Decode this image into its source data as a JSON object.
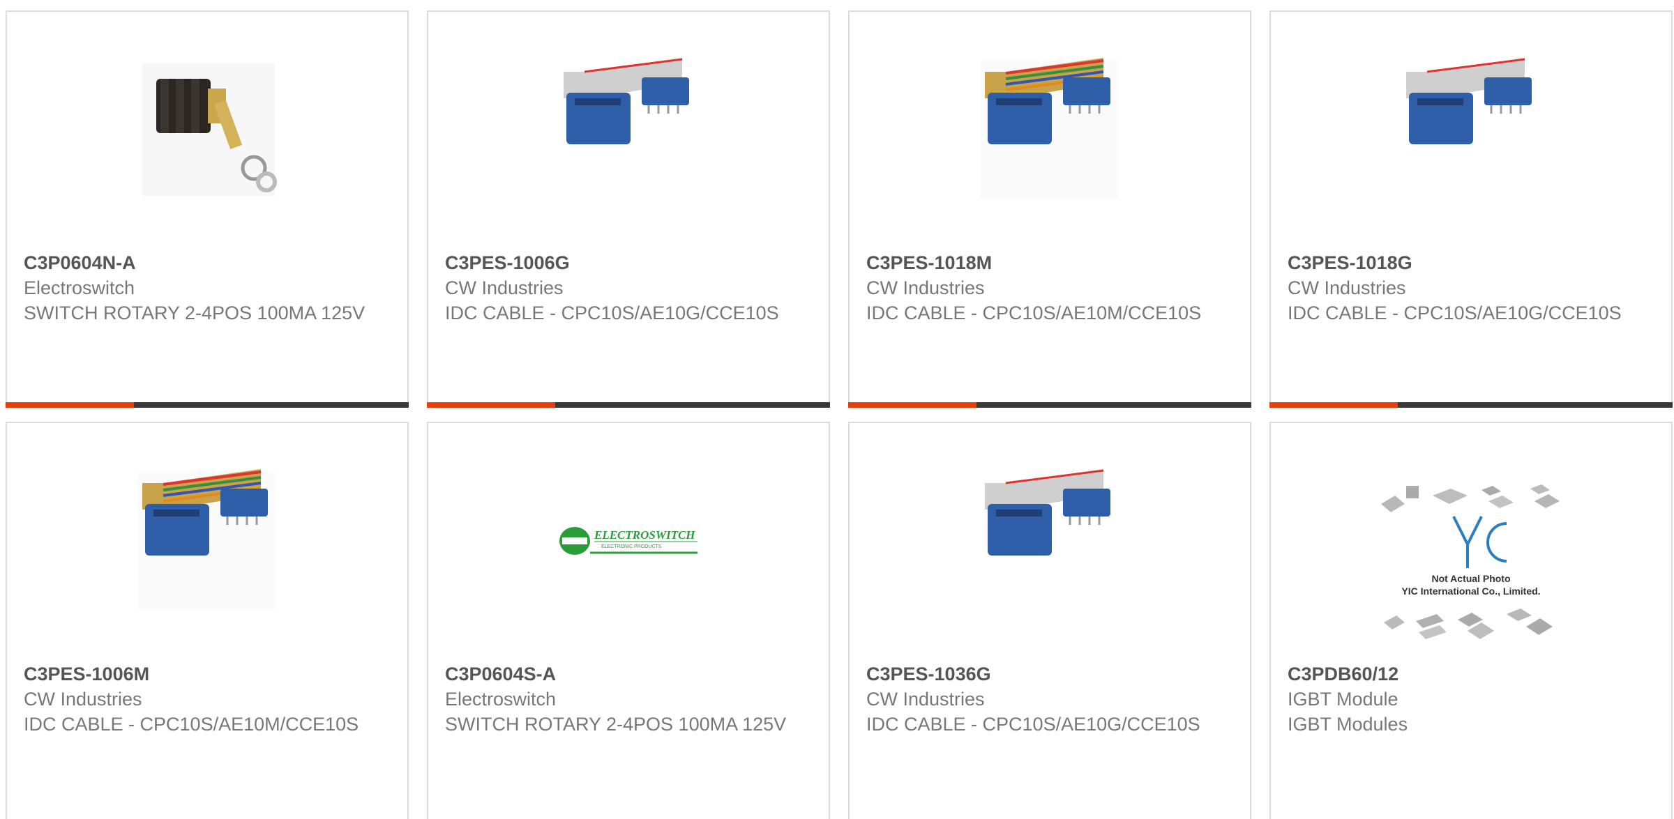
{
  "products": [
    {
      "part": "C3P0604N-A",
      "manufacturer": "Electroswitch",
      "description": "SWITCH ROTARY 2-4POS 100MA 125V",
      "image": "rotary-switch-photo"
    },
    {
      "part": "C3PES-1006G",
      "manufacturer": "CW Industries",
      "description": "IDC CABLE - CPC10S/AE10G/CCE10S",
      "image": "idc-cable-gray-photo"
    },
    {
      "part": "C3PES-1018M",
      "manufacturer": "CW Industries",
      "description": "IDC CABLE - CPC10S/AE10M/CCE10S",
      "image": "idc-cable-multicolor-photo"
    },
    {
      "part": "C3PES-1018G",
      "manufacturer": "CW Industries",
      "description": "IDC CABLE - CPC10S/AE10G/CCE10S",
      "image": "idc-cable-gray-photo"
    },
    {
      "part": "C3PES-1006M",
      "manufacturer": "CW Industries",
      "description": "IDC CABLE - CPC10S/AE10M/CCE10S",
      "image": "idc-cable-multicolor-photo"
    },
    {
      "part": "C3P0604S-A",
      "manufacturer": "Electroswitch",
      "description": "SWITCH ROTARY 2-4POS 100MA 125V",
      "image": "electroswitch-logo"
    },
    {
      "part": "C3PES-1036G",
      "manufacturer": "CW Industries",
      "description": "IDC CABLE - CPC10S/AE10G/CCE10S",
      "image": "idc-cable-gray-photo"
    },
    {
      "part": "C3PDB60/12",
      "manufacturer": "IGBT Module",
      "description": "IGBT Modules",
      "image": "not-actual-photo-placeholder"
    }
  ],
  "logo_text": {
    "electroswitch": "ELECTROSWITCH",
    "electroswitch_sub": "ELECTRONIC PRODUCTS",
    "yic_line1": "Not Actual Photo",
    "yic_line2": "YIC International Co., Limited."
  },
  "colors": {
    "accent": "#e8400c",
    "bar": "#3a3a3a",
    "part_text": "#555555",
    "body_text": "#777777"
  }
}
